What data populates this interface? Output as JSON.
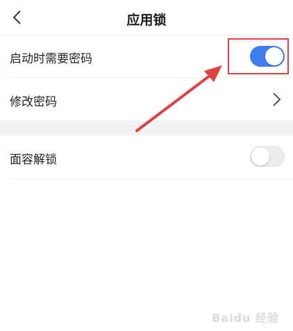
{
  "header": {
    "title": "应用锁",
    "back_icon": "chevron-left-icon"
  },
  "settings": {
    "require_password": {
      "label": "启动时需要密码",
      "enabled": true
    },
    "change_password": {
      "label": "修改密码",
      "icon": "chevron-right-icon"
    },
    "face_unlock": {
      "label": "面容解锁",
      "enabled": false
    }
  },
  "annotation": {
    "color": "#e04040"
  },
  "watermark": "Baidu 经验",
  "colors": {
    "toggle_on": "#3c7df0",
    "toggle_off": "#ededed",
    "section_gap": "#f2f2f2"
  }
}
